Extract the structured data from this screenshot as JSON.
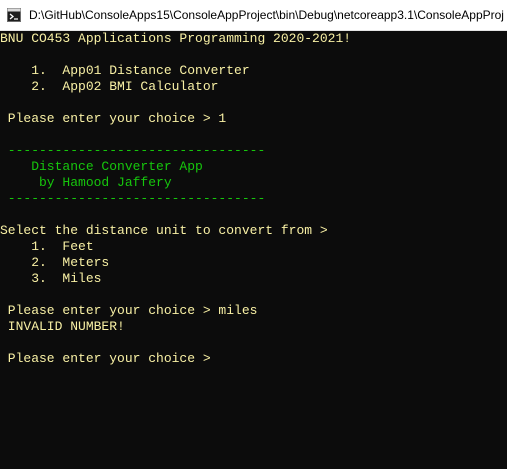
{
  "window": {
    "title": "D:\\GitHub\\ConsoleApps15\\ConsoleAppProject\\bin\\Debug\\netcoreapp3.1\\ConsoleAppProj",
    "icon": "console-app-icon"
  },
  "colors": {
    "background": "#0c0c0c",
    "text_default": "#cccccc",
    "text_yellow": "#f9f1a5",
    "text_green": "#16c60c",
    "titlebar": "#ffffff"
  },
  "console": {
    "header": "BNU CO453 Applications Programming 2020-2021!",
    "menu_item_1": "    1.  App01 Distance Converter",
    "menu_item_2": "    2.  App02 BMI Calculator",
    "prompt_1": " Please enter your choice > 1",
    "divider_top": " ---------------------------------",
    "app_title": "    Distance Converter App",
    "app_author": "     by Hamood Jaffery",
    "divider_bottom": " ---------------------------------",
    "unit_prompt": "Select the distance unit to convert from >",
    "unit_option_1": "    1.  Feet",
    "unit_option_2": "    2.  Meters",
    "unit_option_3": "    3.  Miles",
    "prompt_2": " Please enter your choice > miles",
    "error_message": " INVALID NUMBER!",
    "prompt_3": " Please enter your choice >"
  }
}
